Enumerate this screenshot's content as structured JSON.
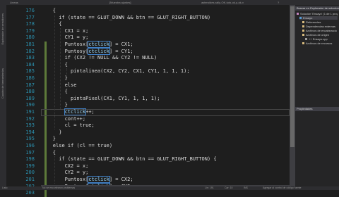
{
  "tabs": {
    "left": "Lineas",
    "middle": "[Muestra ajustes]",
    "right": "asteroides-rally-OK-tuto-ok-y-ok-v",
    "marker": "?"
  },
  "activity_bar": {
    "top_label": "Explorador de servidores",
    "bottom_label": "Cuadro de herramientas"
  },
  "editor": {
    "lines": [
      {
        "num": "176",
        "indent": 4,
        "segments": [
          {
            "t": "{"
          }
        ]
      },
      {
        "num": "177",
        "indent": 6,
        "segments": [
          {
            "t": "if (state == GLUT_DOWN && btn == GLUT_RIGHT_BUTTON)"
          }
        ]
      },
      {
        "num": "178",
        "indent": 6,
        "segments": [
          {
            "t": "{"
          }
        ]
      },
      {
        "num": "179",
        "indent": 8,
        "segments": [
          {
            "t": "CX1 = x;"
          }
        ]
      },
      {
        "num": "180",
        "indent": 8,
        "segments": [
          {
            "t": "CY1 = y;"
          }
        ]
      },
      {
        "num": "181",
        "indent": 8,
        "segments": [
          {
            "t": "Puntosx["
          },
          {
            "t": "ctclick",
            "ref": true
          },
          {
            "t": "] = CX1;"
          }
        ]
      },
      {
        "num": "182",
        "indent": 8,
        "segments": [
          {
            "t": "Puntosy["
          },
          {
            "t": "ctclick",
            "ref": true
          },
          {
            "t": "] = CY1;"
          }
        ]
      },
      {
        "num": "183",
        "indent": 8,
        "segments": [
          {
            "t": "if (CX2 != NULL && CY2 != NULL)"
          }
        ]
      },
      {
        "num": "184",
        "indent": 8,
        "segments": [
          {
            "t": "{"
          }
        ]
      },
      {
        "num": "185",
        "indent": 10,
        "segments": [
          {
            "t": "pintalinea(CX2, CY2, CX1, CY1, 1, 1, 1);"
          }
        ]
      },
      {
        "num": "186",
        "indent": 8,
        "segments": [
          {
            "t": "}"
          }
        ]
      },
      {
        "num": "187",
        "indent": 8,
        "segments": [
          {
            "t": "else"
          }
        ]
      },
      {
        "num": "188",
        "indent": 8,
        "segments": [
          {
            "t": "{"
          }
        ]
      },
      {
        "num": "189",
        "indent": 10,
        "segments": [
          {
            "t": "pintaPixel(CX1, CY1, 1, 1, 1);"
          }
        ]
      },
      {
        "num": "190",
        "indent": 8,
        "segments": [
          {
            "t": "}"
          }
        ]
      },
      {
        "num": "191",
        "indent": 8,
        "segments": [
          {
            "t": "ctclick",
            "ref": true
          },
          {
            "t": "++;"
          }
        ]
      },
      {
        "num": "192",
        "indent": 8,
        "segments": [
          {
            "t": "cont++;"
          }
        ]
      },
      {
        "num": "193",
        "indent": 8,
        "segments": [
          {
            "t": "cl = true;"
          }
        ]
      },
      {
        "num": "194",
        "indent": 6,
        "segments": [
          {
            "t": "}"
          }
        ]
      },
      {
        "num": "195",
        "indent": 4,
        "segments": [
          {
            "t": "}"
          }
        ]
      },
      {
        "num": "196",
        "indent": 4,
        "segments": [
          {
            "t": "else if (cl == true)"
          }
        ]
      },
      {
        "num": "197",
        "indent": 4,
        "segments": [
          {
            "t": "{"
          }
        ]
      },
      {
        "num": "198",
        "indent": 6,
        "segments": [
          {
            "t": "if (state == GLUT_DOWN && btn == GLUT_RIGHT_BUTTON) {"
          }
        ]
      },
      {
        "num": "199",
        "indent": 8,
        "segments": [
          {
            "t": "CX2 = x;"
          }
        ]
      },
      {
        "num": "200",
        "indent": 8,
        "segments": [
          {
            "t": "CY2 = y;"
          }
        ]
      },
      {
        "num": "201",
        "indent": 8,
        "segments": [
          {
            "t": "Puntosx["
          },
          {
            "t": "ctclick",
            "ref": true
          },
          {
            "t": "] = CX2;"
          }
        ]
      },
      {
        "num": "202",
        "indent": 8,
        "segments": [
          {
            "t": "Puntosy["
          },
          {
            "t": "ctclick",
            "ref": true
          },
          {
            "t": "] = CY2;"
          }
        ]
      },
      {
        "num": "203",
        "indent": 8,
        "segments": [
          {
            "t": "pintalinea(CX1, CY1, CX2, CY2, 1, 1, 1);"
          }
        ]
      }
    ],
    "current_line": "191",
    "changed_lines": [
      "181",
      "182",
      "183",
      "184",
      "185",
      "186",
      "187",
      "188",
      "189",
      "190",
      "191",
      "192",
      "193",
      "194",
      "195",
      "196",
      "197",
      "198",
      "199",
      "200",
      "201",
      "202",
      "203"
    ]
  },
  "solution_explorer": {
    "header": "Buscar en Explorador de soluciones",
    "items": [
      {
        "label": "Solución 'Ensayo' (1 de 1 proyecto)",
        "depth": 0,
        "icon_color": "#c586c0"
      },
      {
        "label": "Ensayo",
        "depth": 1,
        "icon_color": "#569cd6",
        "selected": true
      },
      {
        "label": "Referencias",
        "depth": 2,
        "icon_color": "#d7ba7d"
      },
      {
        "label": "Dependencias externas",
        "depth": 2,
        "icon_color": "#d7ba7d"
      },
      {
        "label": "Archivos de encabezado",
        "depth": 2,
        "icon_color": "#d7ba7d"
      },
      {
        "label": "Archivos de origen",
        "depth": 2,
        "icon_color": "#d7ba7d"
      },
      {
        "label": "++ Ensayo.cpp",
        "depth": 3,
        "icon_color": "#9b9b9b"
      },
      {
        "label": "Archivos de recursos",
        "depth": 2,
        "icon_color": "#d7ba7d"
      }
    ]
  },
  "properties": {
    "header": "Propiedades"
  },
  "statusbar": {
    "left": "Listo",
    "middle": "No se encontraron problemas",
    "ln": "Lín: 191",
    "col": "Car: 10",
    "ins": "INS",
    "right": "Agregar al control de código fuente"
  }
}
